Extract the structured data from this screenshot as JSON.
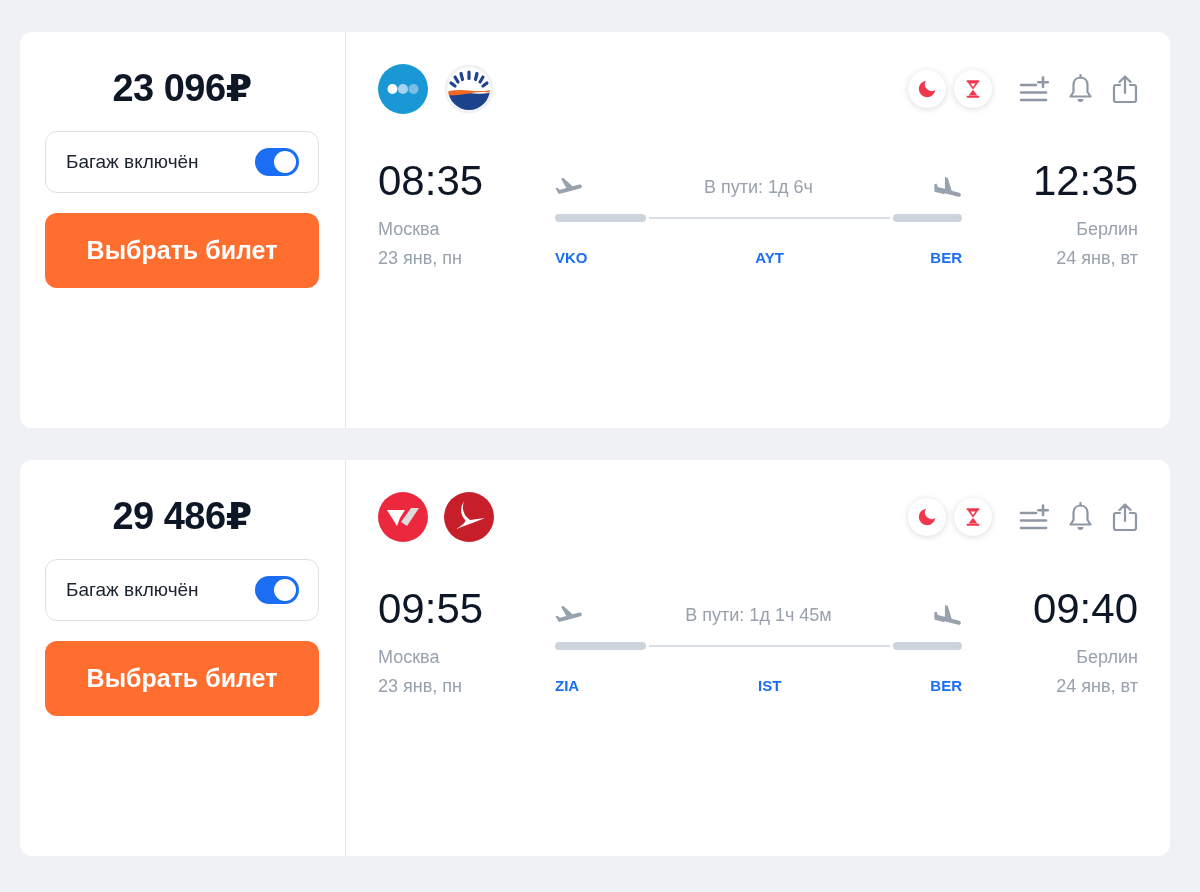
{
  "offers": [
    {
      "price": "23 096₽",
      "baggage": {
        "label": "Багаж включён",
        "on": true
      },
      "select_button": "Выбрать билет",
      "airline_logos": [
        {
          "kind": "dots"
        },
        {
          "kind": "sunrise"
        }
      ],
      "badges": [
        {
          "kind": "moon"
        },
        {
          "kind": "hourglass"
        }
      ],
      "departure": {
        "time": "08:35",
        "city": "Москва",
        "date": "23 янв, пн"
      },
      "duration": "В пути: 1д 6ч",
      "airports": [
        "VKO",
        "AYT",
        "BER"
      ],
      "arrival": {
        "time": "12:35",
        "city": "Берлин",
        "date": "24 янв, вт"
      }
    },
    {
      "price": "29 486₽",
      "baggage": {
        "label": "Багаж включён",
        "on": true
      },
      "select_button": "Выбрать билет",
      "airline_logos": [
        {
          "kind": "w_shape"
        },
        {
          "kind": "wing"
        }
      ],
      "badges": [
        {
          "kind": "moon"
        },
        {
          "kind": "hourglass"
        }
      ],
      "departure": {
        "time": "09:55",
        "city": "Москва",
        "date": "23 янв, пн"
      },
      "duration": "В пути: 1д 1ч 45м",
      "airports": [
        "ZIA",
        "IST",
        "BER"
      ],
      "arrival": {
        "time": "09:40",
        "city": "Берлин",
        "date": "24 янв, вт"
      }
    }
  ]
}
